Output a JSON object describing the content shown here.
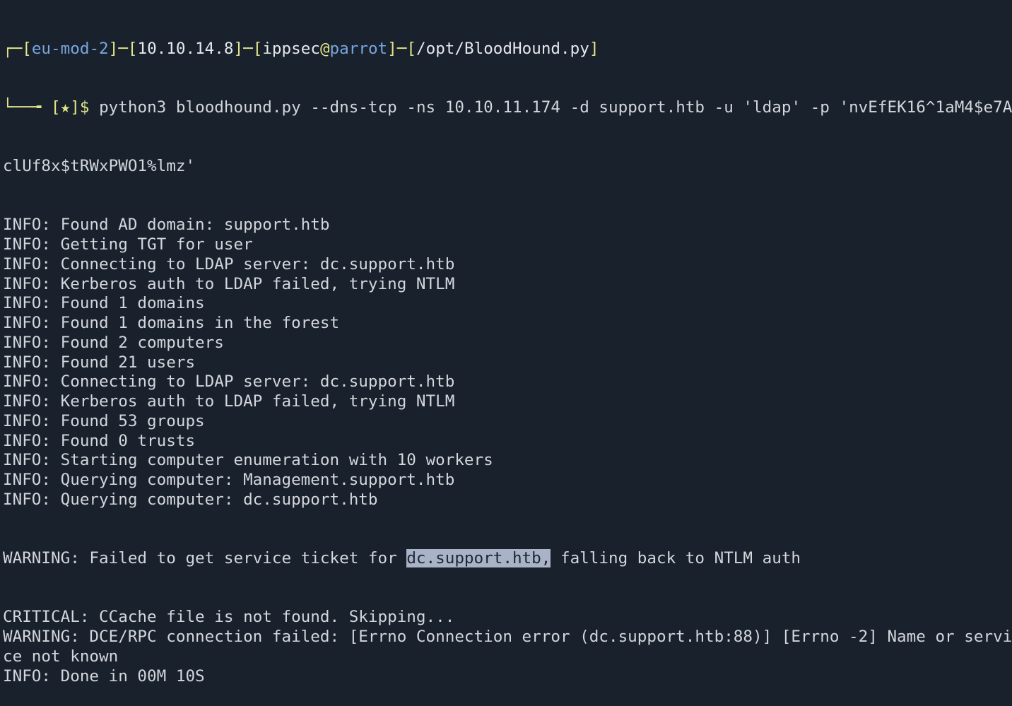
{
  "colors": {
    "background": "#18212c",
    "text": "#d3d6db",
    "prompt_bracket": "#e3e58a",
    "prompt_host": "#79a6de",
    "selection": "#a9b3c7"
  },
  "prompt": {
    "box_top": "┌─",
    "session": "eu-mod-2",
    "ip": "10.10.14.8",
    "user": "ippsec",
    "at": "@",
    "host": "parrot",
    "cwd": "/opt/BloodHound.py",
    "box_bottom": "└──╼ ",
    "star": "★",
    "dollar": "$ ",
    "command": "python3 bloodhound.py --dns-tcp -ns 10.10.11.174 -d support.htb -u 'ldap' -p 'nvEfEK16^1aM4$e7A",
    "command_wrap": "clUf8x$tRWxPWO1%lmz'"
  },
  "output": [
    "INFO: Found AD domain: support.htb",
    "INFO: Getting TGT for user",
    "INFO: Connecting to LDAP server: dc.support.htb",
    "INFO: Kerberos auth to LDAP failed, trying NTLM",
    "INFO: Found 1 domains",
    "INFO: Found 1 domains in the forest",
    "INFO: Found 2 computers",
    "INFO: Found 21 users",
    "INFO: Connecting to LDAP server: dc.support.htb",
    "INFO: Kerberos auth to LDAP failed, trying NTLM",
    "INFO: Found 53 groups",
    "INFO: Found 0 trusts",
    "INFO: Starting computer enumeration with 10 workers",
    "INFO: Querying computer: Management.support.htb",
    "INFO: Querying computer: dc.support.htb"
  ],
  "warning1": {
    "before": "WARNING: Failed to get service ticket for ",
    "selected": "dc.support.htb,",
    "after": " falling back to NTLM auth"
  },
  "output2": [
    "CRITICAL: CCache file is not found. Skipping...",
    "WARNING: DCE/RPC connection failed: [Errno Connection error (dc.support.htb:88)] [Errno -2] Name or servi",
    "ce not known",
    "INFO: Done in 00M 10S"
  ]
}
